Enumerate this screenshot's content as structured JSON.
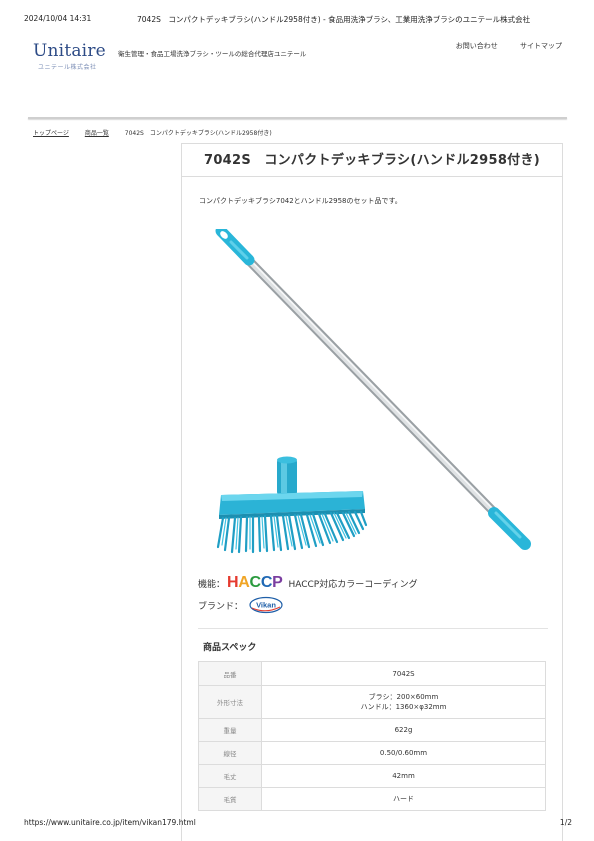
{
  "print_header": {
    "date": "2024/10/04 14:31",
    "title": "7042S　コンパクトデッキブラシ(ハンドル2958付き) - 食品用洗浄ブラシ、工業用洗浄ブラシのユニテール株式会社"
  },
  "header": {
    "logo": "Unitaire",
    "logo_sub": "ユニテール株式会社",
    "tagline": "衛生管理・食品工場洗浄ブラシ・ツールの総合代理店ユニテール",
    "links": [
      "お問い合わせ",
      "サイトマップ"
    ]
  },
  "breadcrumb": [
    "トップページ",
    "商品一覧",
    "7042S　コンパクトデッキブラシ(ハンドル2958付き)"
  ],
  "product": {
    "title": "7042S　コンパクトデッキブラシ(ハンドル2958付き)",
    "description": "コンパクトデッキブラシ7042とハンドル2958のセット品です。",
    "image_icon": "deck-brush-with-handle-image",
    "color": "#29b6d9",
    "feature_label": "機能：",
    "haccp_logo": "HACCP",
    "feature_text": "HACCP対応カラーコーディング",
    "brand_label": "ブランド：",
    "brand_logo": "Vikan"
  },
  "specs": {
    "heading": "商品スペック",
    "rows": [
      {
        "label": "品番",
        "value": "7042S"
      },
      {
        "label": "外形寸法",
        "value": "ブラシ：200×60mm",
        "value2": "ハンドル：1360×φ32mm"
      },
      {
        "label": "重量",
        "value": "622g"
      },
      {
        "label": "線径",
        "value": "0.50/0.60mm"
      },
      {
        "label": "毛丈",
        "value": "42mm"
      },
      {
        "label": "毛質",
        "value": "ハード"
      }
    ]
  },
  "print_footer": {
    "url": "https://www.unitaire.co.jp/item/vikan179.html",
    "page": "1/2"
  }
}
